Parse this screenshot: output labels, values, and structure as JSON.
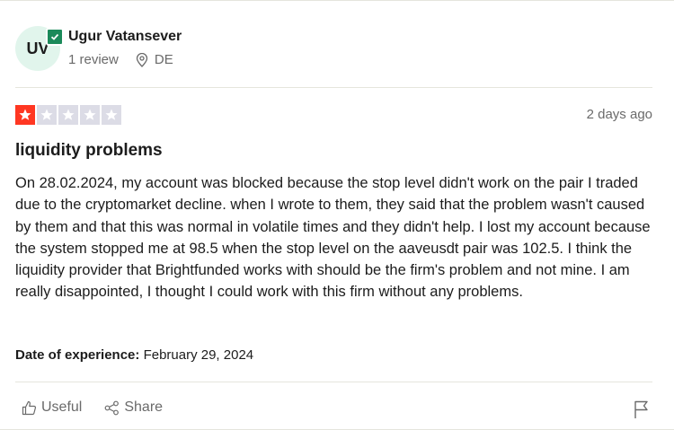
{
  "reviewer": {
    "initials": "UV",
    "name": "Ugur Vatansever",
    "reviews": "1 review",
    "country": "DE"
  },
  "rating": {
    "value": 1,
    "max": 5,
    "filled_color": "#ff3722",
    "empty_color": "#dcdce6"
  },
  "review": {
    "date": "2 days ago",
    "title": "liquidity problems",
    "body": "On 28.02.2024, my account was blocked because the stop level didn't work on the pair I traded due to the cryptomarket decline. when I wrote to them, they said that the problem wasn't caused by them and that this was normal in volatile times and they didn't help. I lost my account because the system stopped me at 98.5 when the stop level on the aaveusdt pair was 102.5. I think the liquidity provider that Brightfunded works with should be the firm's problem and not mine. I am really disappointed, I thought I could work with this firm without any problems.",
    "experience_label": "Date of experience:",
    "experience_date": "February 29, 2024"
  },
  "actions": {
    "useful": "Useful",
    "share": "Share",
    "useful_icon": "thumbs-up-icon",
    "share_icon": "share-icon",
    "flag_icon": "flag-icon"
  }
}
